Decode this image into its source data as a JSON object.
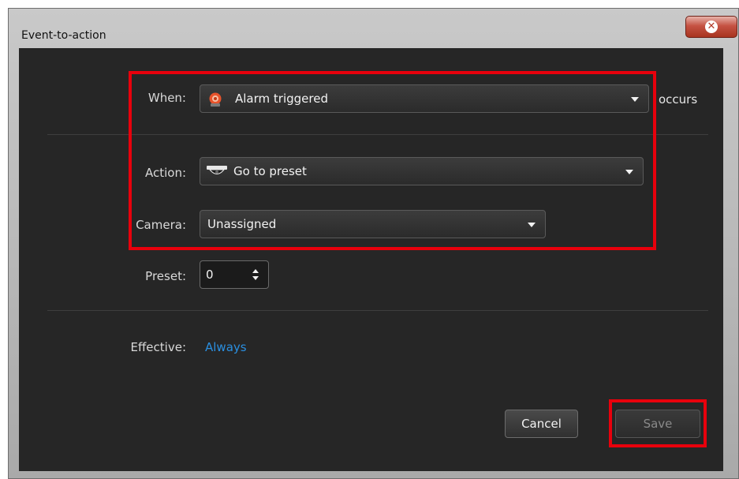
{
  "window": {
    "title": "Event-to-action",
    "close_icon": "close-icon"
  },
  "form": {
    "when": {
      "label": "When:",
      "value": "Alarm triggered",
      "icon": "alarm-icon",
      "suffix": "occurs"
    },
    "action": {
      "label": "Action:",
      "value": "Go to preset",
      "icon": "ptz-camera-icon"
    },
    "camera": {
      "label": "Camera:",
      "value": "Unassigned"
    },
    "preset": {
      "label": "Preset:",
      "value": "0"
    },
    "effective": {
      "label": "Effective:",
      "value": "Always"
    }
  },
  "buttons": {
    "cancel": "Cancel",
    "save": "Save"
  },
  "colors": {
    "highlight": "#e8000c",
    "link": "#2a8fe0",
    "panel": "#262626"
  }
}
